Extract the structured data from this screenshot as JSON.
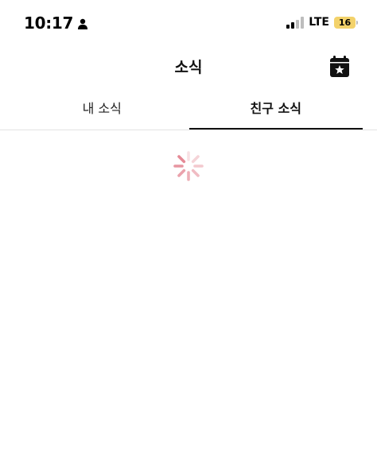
{
  "status_bar": {
    "time": "10:17",
    "network": "LTE",
    "battery": "16",
    "battery_color": "#f3d26b"
  },
  "header": {
    "title": "소식",
    "calendar_icon": "calendar-star-icon"
  },
  "tabs": [
    {
      "label": "내 소식",
      "active": false
    },
    {
      "label": "친구 소식",
      "active": true
    }
  ],
  "content": {
    "state": "loading",
    "spinner_color": "#e58a96"
  }
}
